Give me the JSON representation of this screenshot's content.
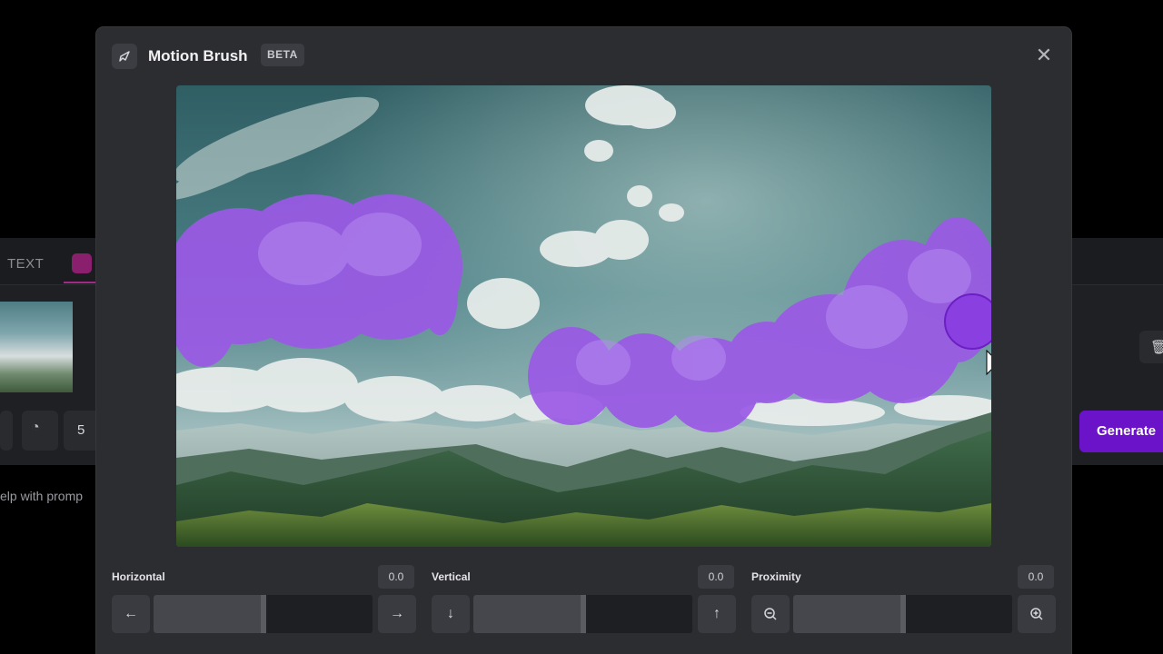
{
  "background": {
    "tab_text": "TEXT",
    "speed_value": "5",
    "help_text": "elp with promp",
    "generate_label": "Generate"
  },
  "modal": {
    "title": "Motion Brush",
    "badge": "BETA",
    "brush_color": "#9b59e6",
    "controls": [
      {
        "label": "Horizontal",
        "value": "0.0",
        "level": 0.5,
        "left_icon": "arrow-left-icon",
        "right_icon": "arrow-right-icon"
      },
      {
        "label": "Vertical",
        "value": "0.0",
        "level": 0.5,
        "left_icon": "arrow-down-icon",
        "right_icon": "arrow-up-icon"
      },
      {
        "label": "Proximity",
        "value": "0.0",
        "level": 0.5,
        "left_icon": "zoom-out-icon",
        "right_icon": "zoom-in-icon"
      }
    ]
  },
  "colors": {
    "accent": "#6b13c9",
    "modal_bg": "#2c2d31",
    "brush": "#9b59e6"
  }
}
